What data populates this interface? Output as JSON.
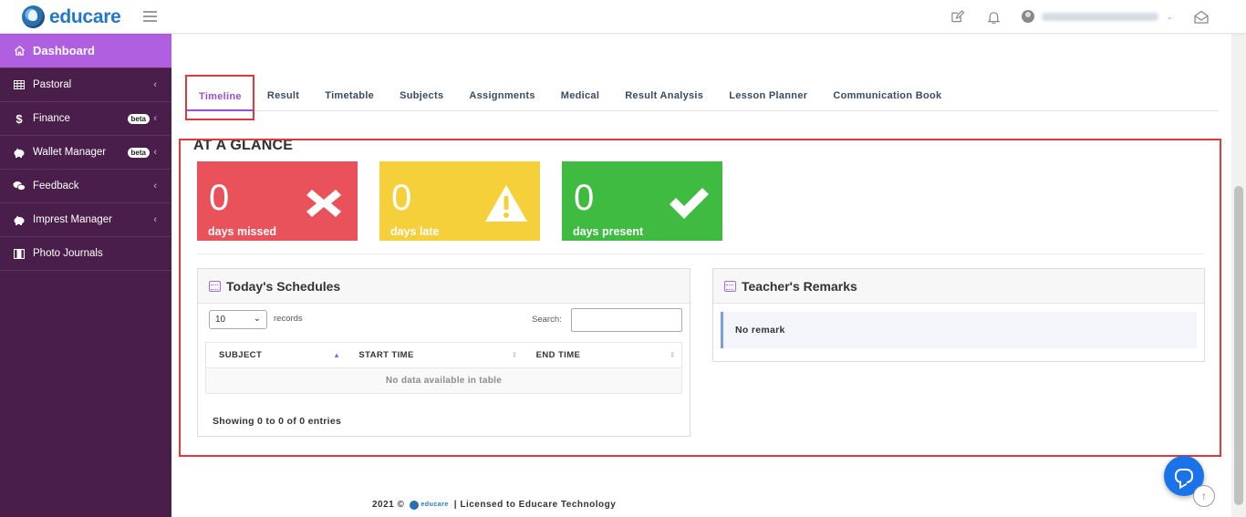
{
  "brand": {
    "name": "educare",
    "color": "#2377c9"
  },
  "topbar": {
    "icons": [
      "edit-icon",
      "bell-icon",
      "user-avatar-icon",
      "chevron-down-icon",
      "envelope-open-icon"
    ]
  },
  "sidebar": {
    "bg_color": "#4a1e4a",
    "active_color": "#b05fe0",
    "items": [
      {
        "label": "Dashboard",
        "icon": "home-icon",
        "active": true
      },
      {
        "label": "Pastoral",
        "icon": "table-icon"
      },
      {
        "label": "Finance",
        "icon": "dollar-icon",
        "badge": "beta"
      },
      {
        "label": "Wallet Manager",
        "icon": "piggy-bank-icon",
        "badge": "beta"
      },
      {
        "label": "Feedback",
        "icon": "comments-icon"
      },
      {
        "label": "Impres​t Manager",
        "icon": "piggy-bank-icon"
      },
      {
        "label": "Photo Journals",
        "icon": "film-icon"
      }
    ]
  },
  "tabs": [
    {
      "label": "Timeline",
      "active": true
    },
    {
      "label": "Result"
    },
    {
      "label": "Timetable"
    },
    {
      "label": "Subjects"
    },
    {
      "label": "Assignments"
    },
    {
      "label": "Medical"
    },
    {
      "label": "Result Analysis"
    },
    {
      "label": "Lesson Planner"
    },
    {
      "label": "Communication Book"
    }
  ],
  "glance": {
    "title": "AT A GLANCE",
    "cards": [
      {
        "value": "0",
        "label": "days missed",
        "color": "#e9525b",
        "icon": "times-icon"
      },
      {
        "value": "0",
        "label": "days late",
        "color": "#f5d03a",
        "icon": "warning-icon"
      },
      {
        "value": "0",
        "label": "days present",
        "color": "#3ebb40",
        "icon": "check-icon"
      }
    ]
  },
  "schedules": {
    "title": "Today's Schedules",
    "page_size": "10",
    "records_label": "records",
    "search_label": "Search:",
    "columns": [
      "SUBJECT",
      "START TIME",
      "END TIME"
    ],
    "empty_text": "No data available in table",
    "showing_text": "Showing 0 to 0 of 0 entries"
  },
  "remarks": {
    "title": "Teacher's Remarks",
    "text": "No remark"
  },
  "footer": {
    "year": "2021 ©",
    "logo_text": "educare",
    "license": "| Licensed to Educare Technology"
  },
  "highlight_color": "#e0383b"
}
